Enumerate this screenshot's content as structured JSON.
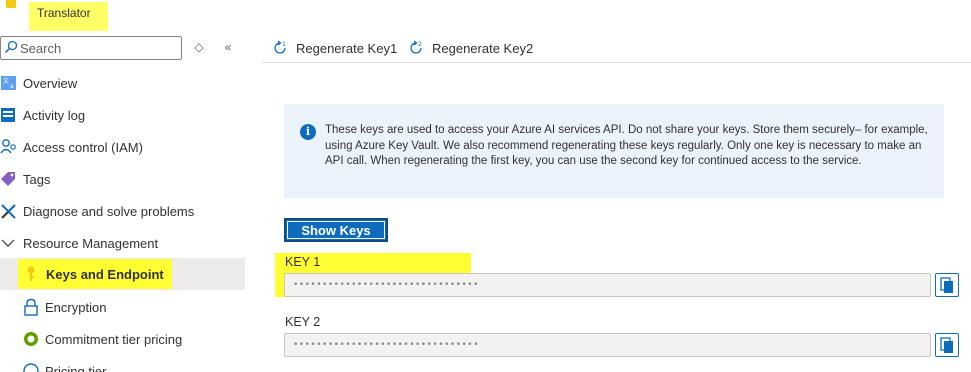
{
  "header": {
    "resource_type": "Translator"
  },
  "sidebar": {
    "search": {
      "placeholder": "Search",
      "value": ""
    },
    "items": [
      {
        "label": "Overview",
        "icon": "overview-icon"
      },
      {
        "label": "Activity log",
        "icon": "activity-log-icon"
      },
      {
        "label": "Access control (IAM)",
        "icon": "iam-people-icon"
      },
      {
        "label": "Tags",
        "icon": "tag-icon"
      },
      {
        "label": "Diagnose and solve problems",
        "icon": "wrench-icon"
      },
      {
        "label": "Resource Management",
        "icon": "chevron-down-icon"
      },
      {
        "label": "Keys and Endpoint",
        "icon": "key-icon",
        "selected": true
      },
      {
        "label": "Encryption",
        "icon": "lock-icon"
      },
      {
        "label": "Commitment tier pricing",
        "icon": "commitment-icon"
      },
      {
        "label": "Pricing tier",
        "icon": "pricing-icon"
      }
    ]
  },
  "toolbar": {
    "regenerate_key1": "Regenerate Key1",
    "regenerate_key2": "Regenerate Key2"
  },
  "info": {
    "text": "These keys are used to access your Azure AI services API. Do not share your keys. Store them securely– for example, using Azure Key Vault. We also recommend regenerating these keys regularly. Only one key is necessary to make an API call. When regenerating the first key, you can use the second key for continued access to the service."
  },
  "keys": {
    "show_keys_label": "Show Keys",
    "key1": {
      "label": "KEY 1",
      "value": "••••••••••••••••••••••••••••••••"
    },
    "key2": {
      "label": "KEY 2",
      "value": "••••••••••••••••••••••••••••••••"
    }
  },
  "colors": {
    "accent": "#0f6cbd",
    "highlight": "#ffff33",
    "info_bg": "#ebf3fc",
    "selected_bg": "#edebe9"
  }
}
